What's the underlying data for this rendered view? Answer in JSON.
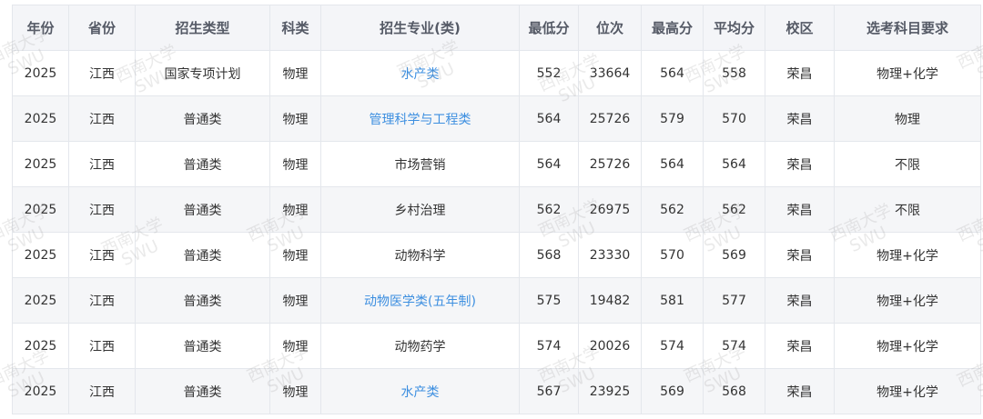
{
  "table": {
    "headers": [
      "年份",
      "省份",
      "招生类型",
      "科类",
      "招生专业(类)",
      "最低分",
      "位次",
      "最高分",
      "平均分",
      "校区",
      "选考科目要求"
    ],
    "rows": [
      {
        "year": "2025",
        "province": "江西",
        "type": "国家专项计划",
        "category": "物理",
        "major": "水产类",
        "major_link": true,
        "min": "552",
        "rank": "33664",
        "max": "564",
        "avg": "558",
        "campus": "荣昌",
        "subjects": "物理+化学"
      },
      {
        "year": "2025",
        "province": "江西",
        "type": "普通类",
        "category": "物理",
        "major": "管理科学与工程类",
        "major_link": true,
        "min": "564",
        "rank": "25726",
        "max": "579",
        "avg": "570",
        "campus": "荣昌",
        "subjects": "物理"
      },
      {
        "year": "2025",
        "province": "江西",
        "type": "普通类",
        "category": "物理",
        "major": "市场营销",
        "major_link": false,
        "min": "564",
        "rank": "25726",
        "max": "564",
        "avg": "564",
        "campus": "荣昌",
        "subjects": "不限"
      },
      {
        "year": "2025",
        "province": "江西",
        "type": "普通类",
        "category": "物理",
        "major": "乡村治理",
        "major_link": false,
        "min": "562",
        "rank": "26975",
        "max": "562",
        "avg": "562",
        "campus": "荣昌",
        "subjects": "不限"
      },
      {
        "year": "2025",
        "province": "江西",
        "type": "普通类",
        "category": "物理",
        "major": "动物科学",
        "major_link": false,
        "min": "568",
        "rank": "23330",
        "max": "570",
        "avg": "569",
        "campus": "荣昌",
        "subjects": "物理+化学"
      },
      {
        "year": "2025",
        "province": "江西",
        "type": "普通类",
        "category": "物理",
        "major": "动物医学类(五年制)",
        "major_link": true,
        "min": "575",
        "rank": "19482",
        "max": "581",
        "avg": "577",
        "campus": "荣昌",
        "subjects": "物理+化学"
      },
      {
        "year": "2025",
        "province": "江西",
        "type": "普通类",
        "category": "物理",
        "major": "动物药学",
        "major_link": false,
        "min": "574",
        "rank": "20026",
        "max": "574",
        "avg": "574",
        "campus": "荣昌",
        "subjects": "物理+化学"
      },
      {
        "year": "2025",
        "province": "江西",
        "type": "普通类",
        "category": "物理",
        "major": "水产类",
        "major_link": true,
        "min": "567",
        "rank": "23925",
        "max": "569",
        "avg": "568",
        "campus": "荣昌",
        "subjects": "物理+化学"
      }
    ]
  },
  "watermark": {
    "line1": "西南大学",
    "line2": "SWU"
  },
  "colors": {
    "link": "#3d8fe0",
    "header_bg": "#f4f5f8",
    "alt_row_bg": "#f5f6f8",
    "border": "#e4e7ec"
  }
}
